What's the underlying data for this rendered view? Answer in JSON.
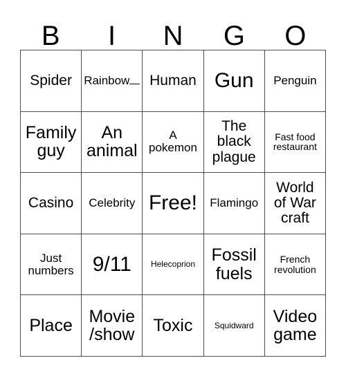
{
  "card": {
    "title": "BINGO",
    "header_letters": [
      "B",
      "I",
      "N",
      "G",
      "O"
    ],
    "border_color": "#4d4d4d",
    "text_color": "#000000",
    "background_color": "#ffffff",
    "columns": 5,
    "rows": 5,
    "free_space": {
      "row": 3,
      "column": 3,
      "label": "Free!"
    },
    "cells": [
      {
        "text": "Spider",
        "size": "md"
      },
      {
        "text": "Rainbow",
        "size": "sm",
        "has_blank_line": true
      },
      {
        "text": "Human",
        "size": "md"
      },
      {
        "text": "Gun",
        "size": "xl"
      },
      {
        "text": "Penguin",
        "size": "sm"
      },
      {
        "text": "Family\nguy",
        "size": "lg"
      },
      {
        "text": "An\nanimal",
        "size": "lg"
      },
      {
        "text": "A\npokemon",
        "size": "sm"
      },
      {
        "text": "The\nblack\nplague",
        "size": "md"
      },
      {
        "text": "Fast food\nrestaurant",
        "size": "xs"
      },
      {
        "text": "Casino",
        "size": "md"
      },
      {
        "text": "Celebrity",
        "size": "sm"
      },
      {
        "text": "Free!",
        "size": "xl"
      },
      {
        "text": "Flamingo",
        "size": "sm"
      },
      {
        "text": "World\nof War\ncraft",
        "size": "md"
      },
      {
        "text": "Just\nnumbers",
        "size": "sm"
      },
      {
        "text": "9/11",
        "size": "xl"
      },
      {
        "text": "Helecoprion",
        "size": "xxs"
      },
      {
        "text": "Fossil\nfuels",
        "size": "lg"
      },
      {
        "text": "French\nrevolution",
        "size": "xs"
      },
      {
        "text": "Place",
        "size": "lg"
      },
      {
        "text": "Movie\n/show",
        "size": "lg"
      },
      {
        "text": "Toxic",
        "size": "lg"
      },
      {
        "text": "Squidward",
        "size": "xxs"
      },
      {
        "text": "Video\ngame",
        "size": "lg"
      }
    ]
  }
}
